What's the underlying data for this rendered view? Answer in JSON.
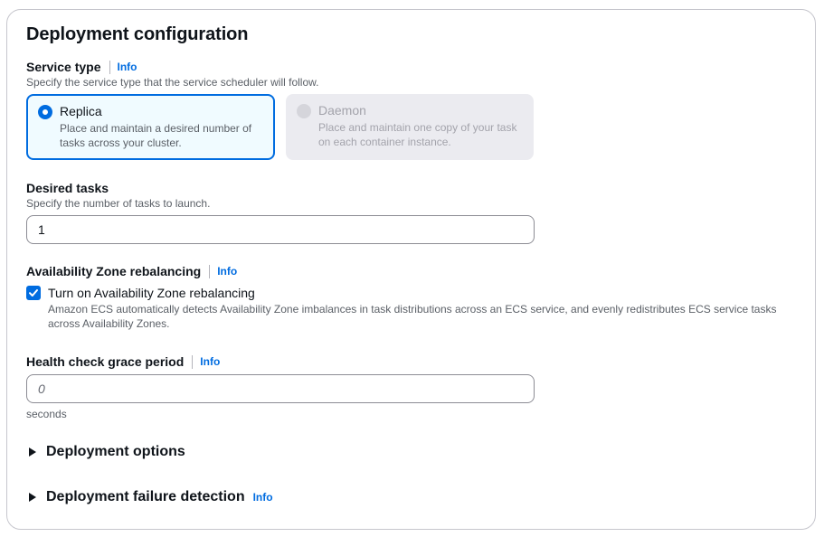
{
  "section": {
    "title": "Deployment configuration"
  },
  "service_type": {
    "label": "Service type",
    "info": "Info",
    "description": "Specify the service type that the service scheduler will follow.",
    "options": [
      {
        "title": "Replica",
        "description": "Place and maintain a desired number of tasks across your cluster.",
        "selected": true,
        "disabled": false
      },
      {
        "title": "Daemon",
        "description": "Place and maintain one copy of your task on each container instance.",
        "selected": false,
        "disabled": true
      }
    ]
  },
  "desired_tasks": {
    "label": "Desired tasks",
    "description": "Specify the number of tasks to launch.",
    "value": "1"
  },
  "az_rebalancing": {
    "label": "Availability Zone rebalancing",
    "info": "Info",
    "checkbox_label": "Turn on Availability Zone rebalancing",
    "checked": true,
    "checkbox_description": "Amazon ECS automatically detects Availability Zone imbalances in task distributions across an ECS service, and evenly redistributes ECS service tasks across Availability Zones."
  },
  "health_check": {
    "label": "Health check grace period",
    "info": "Info",
    "placeholder": "0",
    "unit": "seconds"
  },
  "expanders": {
    "deployment_options": {
      "label": "Deployment options"
    },
    "failure_detection": {
      "label": "Deployment failure detection",
      "info": "Info"
    }
  },
  "colors": {
    "accent": "#006ce0",
    "border": "#c6c6cd",
    "text": "#0f141a",
    "muted": "#5a5f66"
  }
}
